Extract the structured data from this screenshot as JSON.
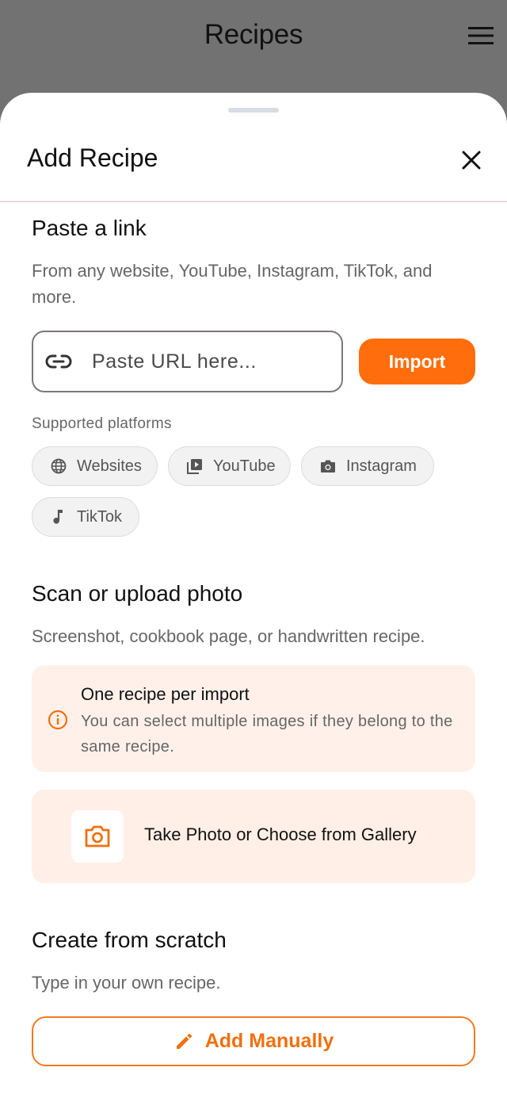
{
  "app": {
    "title": "Recipes",
    "menu_icon": "hamburger-menu-icon"
  },
  "sheet": {
    "title": "Add Recipe",
    "close_icon": "close-icon"
  },
  "link_section": {
    "title": "Paste a link",
    "description": "From any website, YouTube, Instagram, TikTok, and more.",
    "url_placeholder": "Paste URL here...",
    "url_value": "",
    "import_label": "Import",
    "platforms_label": "Supported platforms",
    "platforms": [
      {
        "label": "Websites",
        "icon": "globe-icon"
      },
      {
        "label": "YouTube",
        "icon": "video-library-icon"
      },
      {
        "label": "Instagram",
        "icon": "camera-icon"
      },
      {
        "label": "TikTok",
        "icon": "music-note-icon"
      }
    ]
  },
  "photo_section": {
    "title": "Scan or upload photo",
    "description": "Screenshot, cookbook page, or handwritten recipe.",
    "info_title": "One recipe per import",
    "info_text": "You can select multiple images if they belong to the same recipe.",
    "action_label": "Take Photo or Choose from Gallery"
  },
  "scratch_section": {
    "title": "Create from scratch",
    "description": "Type in your own recipe.",
    "button_label": "Add Manually"
  },
  "colors": {
    "accent": "#ff6d0d",
    "accent_text": "#f0700f",
    "info_bg": "#fff1ea",
    "overlay": "#727272"
  }
}
